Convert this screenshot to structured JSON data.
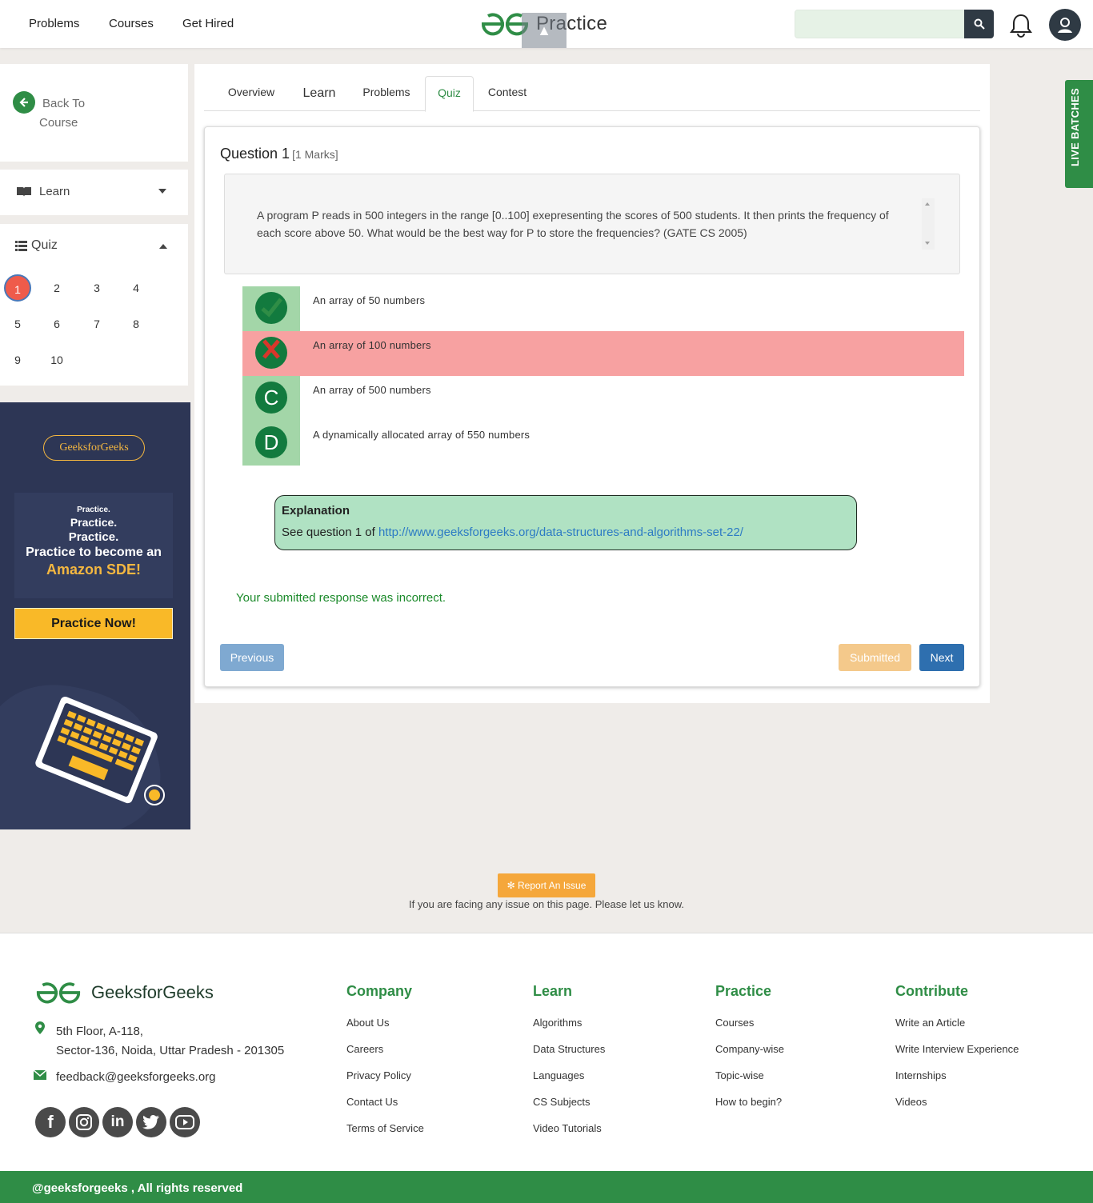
{
  "header": {
    "nav": [
      "Problems",
      "Courses",
      "Get Hired"
    ],
    "logo_text": "Practice",
    "scroll_top_glyph": "▲",
    "search_placeholder": "",
    "brand_color": "#2f8d46"
  },
  "sidebar": {
    "back_label": "Back To Course",
    "learn_label": "Learn",
    "quiz_label": "Quiz",
    "questions": [
      "1",
      "2",
      "3",
      "4",
      "5",
      "6",
      "7",
      "8",
      "9",
      "10"
    ],
    "active_question": "1"
  },
  "promo": {
    "logo": "GeeksforGeeks",
    "line1": "Practice.",
    "line2": "Practice.",
    "line3": "Practice.",
    "line4": "Practice to become an",
    "line5": "Amazon SDE!",
    "button": "Practice Now!"
  },
  "tabs": [
    "Overview",
    "Learn",
    "Problems",
    "Quiz",
    "Contest"
  ],
  "active_tab": "Quiz",
  "question": {
    "title": "Question 1",
    "marks": "[1 Marks]",
    "text": "A program P reads in 500 integers in the range [0..100] exepresenting the scores of 500 students. It then prints the frequency of each score above 50. What would be the best way for P to store the frequencies? (GATE CS 2005)",
    "options": [
      {
        "marker": "check-icon",
        "text": "An array of 50 numbers",
        "state": "correct"
      },
      {
        "marker": "cross-icon",
        "text": "An array of 100 numbers",
        "state": "selected-wrong"
      },
      {
        "marker": "C",
        "text": "An array of 500 numbers",
        "state": "none"
      },
      {
        "marker": "D",
        "text": "A dynamically allocated array of 550 numbers",
        "state": "none"
      }
    ],
    "explanation_title": "Explanation",
    "explanation_prefix": "See question 1 of ",
    "explanation_link": "http://www.geeksforgeeks.org/data-structures-and-algorithms-set-22/",
    "result": "Your submitted response was incorrect."
  },
  "buttons": {
    "previous": "Previous",
    "submitted": "Submitted",
    "next": "Next"
  },
  "live_batches": "LIVE BATCHES",
  "report": {
    "button": "Report An Issue",
    "text": "If you are facing any issue on this page. Please let us know."
  },
  "footer": {
    "brand": "GeeksforGeeks",
    "address_line1": "5th Floor, A-118,",
    "address_line2": "Sector-136, Noida, Uttar Pradesh - 201305",
    "email": "feedback@geeksforgeeks.org",
    "socials": [
      "facebook-icon",
      "instagram-icon",
      "linkedin-icon",
      "twitter-icon",
      "youtube-icon"
    ],
    "columns": [
      {
        "heading": "Company",
        "links": [
          "About Us",
          "Careers",
          "Privacy Policy",
          "Contact Us",
          "Terms of Service"
        ]
      },
      {
        "heading": "Learn",
        "links": [
          "Algorithms",
          "Data Structures",
          "Languages",
          "CS Subjects",
          "Video Tutorials"
        ]
      },
      {
        "heading": "Practice",
        "links": [
          "Courses",
          "Company-wise",
          "Topic-wise",
          "How to begin?"
        ]
      },
      {
        "heading": "Contribute",
        "links": [
          "Write an Article",
          "Write Interview Experience",
          "Internships",
          "Videos"
        ]
      }
    ],
    "copyright": "@geeksforgeeks , All rights reserved"
  }
}
